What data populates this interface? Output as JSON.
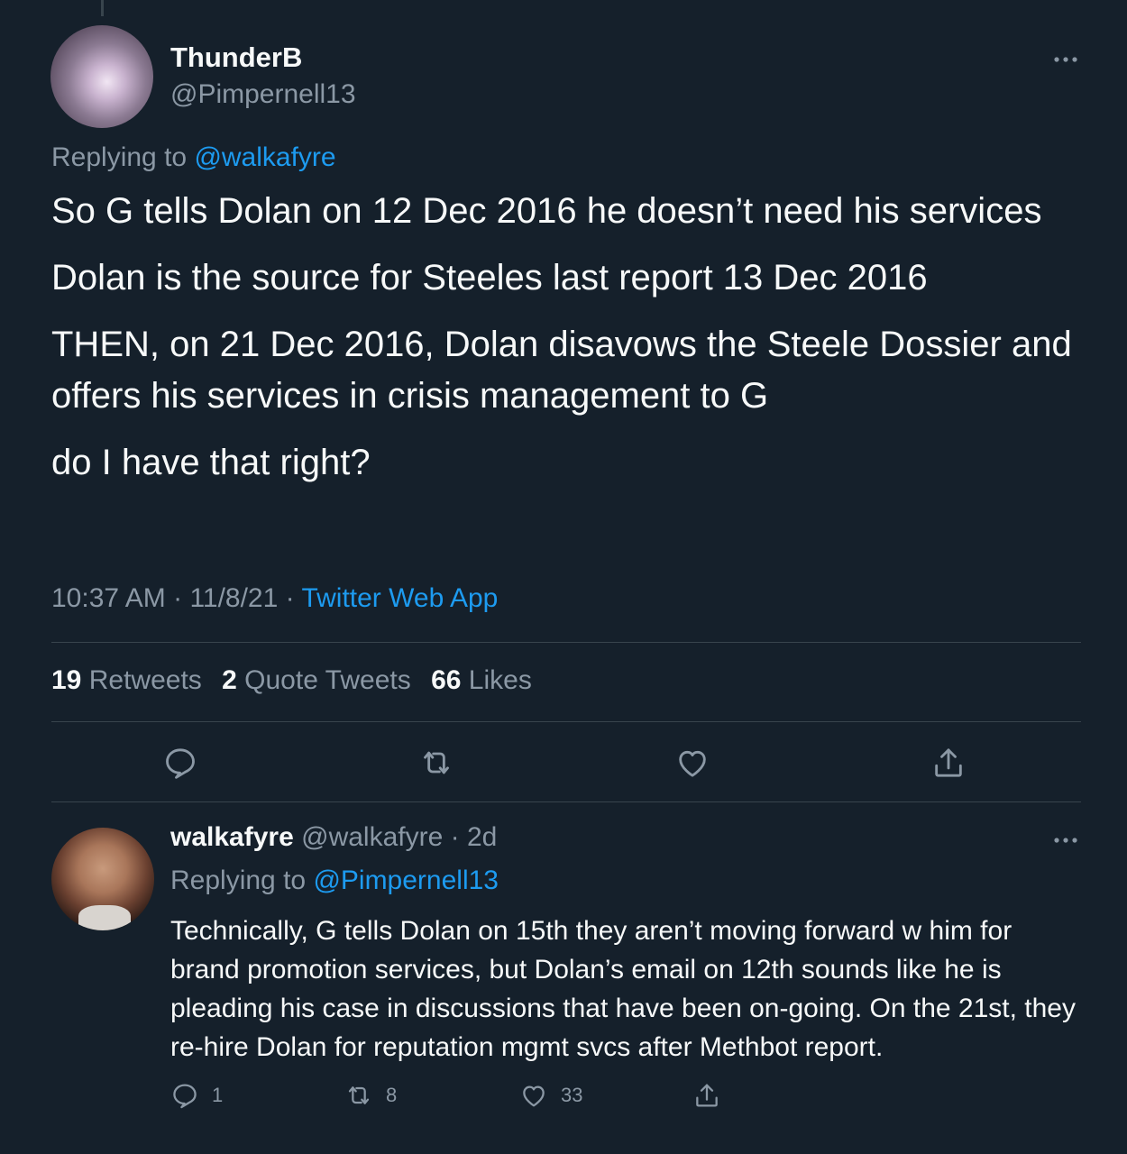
{
  "tweet": {
    "author_name": "ThunderB",
    "author_handle": "@Pimpernell13",
    "replying_to_label": "Replying to",
    "replying_to_handle": "@walkafyre",
    "paragraphs": [
      "So G tells Dolan on 12 Dec 2016 he doesn’t need his services",
      "Dolan is the source for Steeles last report 13 Dec 2016",
      "THEN, on 21 Dec 2016, Dolan disavows the Steele Dossier and offers his services in crisis management to G",
      "do I have that right?"
    ],
    "time": "10:37 AM",
    "date": "11/8/21",
    "source": "Twitter Web App",
    "stats": {
      "retweets_count": "19",
      "retweets_label": "Retweets",
      "quotes_count": "2",
      "quotes_label": "Quote Tweets",
      "likes_count": "66",
      "likes_label": "Likes"
    },
    "actions": [
      "reply-icon",
      "retweet-icon",
      "like-icon",
      "share-icon"
    ]
  },
  "reply": {
    "author_name": "walkafyre",
    "author_handle": "@walkafyre",
    "age": "2d",
    "replying_to_label": "Replying to",
    "replying_to_handle": "@Pimpernell13",
    "text": "Technically, G tells Dolan on 15th they aren’t moving forward w him for brand promotion services, but Dolan’s email on 12th sounds like he is pleading his case in discussions that have been on-going. On the 21st, they re-hire Dolan for reputation mgmt svcs after Methbot report.",
    "reply_count": "1",
    "retweet_count": "8",
    "like_count": "33"
  },
  "colors": {
    "background": "#15202b",
    "text": "#f7f9f9",
    "secondary": "#8b98a5",
    "accent": "#1d9bf0",
    "divider": "#38444d"
  }
}
